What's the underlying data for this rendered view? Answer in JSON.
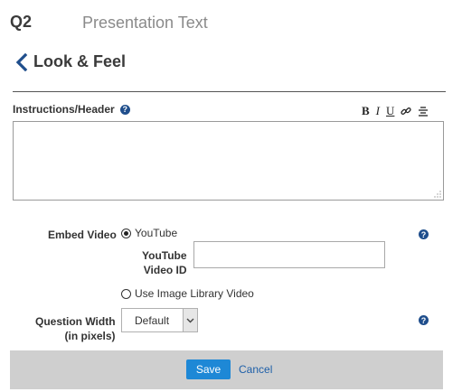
{
  "header": {
    "question_number": "Q2",
    "question_type": "Presentation Text"
  },
  "nav": {
    "back_label": "Look & Feel"
  },
  "instructions": {
    "label": "Instructions/Header",
    "help_icon": "question-circle-icon",
    "toolbar": {
      "bold": "B",
      "italic": "I",
      "underline": "U",
      "link_icon": "link-icon",
      "align_icon": "align-center-icon"
    },
    "value": ""
  },
  "embed": {
    "label": "Embed Video",
    "options": [
      {
        "label": "YouTube",
        "selected": true
      },
      {
        "label": "Use Image Library Video",
        "selected": false
      }
    ],
    "youtube_id_label_1": "YouTube",
    "youtube_id_label_2": "Video ID",
    "youtube_id_value": "",
    "help_icon": "question-circle-icon"
  },
  "question_width": {
    "label_1": "Question Width",
    "label_2": "(in pixels)",
    "selected": "Default",
    "help_icon": "question-circle-icon"
  },
  "footer": {
    "save_label": "Save",
    "cancel_label": "Cancel"
  },
  "colors": {
    "accent": "#1e88d6",
    "link": "#1e5fa8",
    "help_icon": "#1f4e8c",
    "footer_bg": "#cfcfcf"
  }
}
